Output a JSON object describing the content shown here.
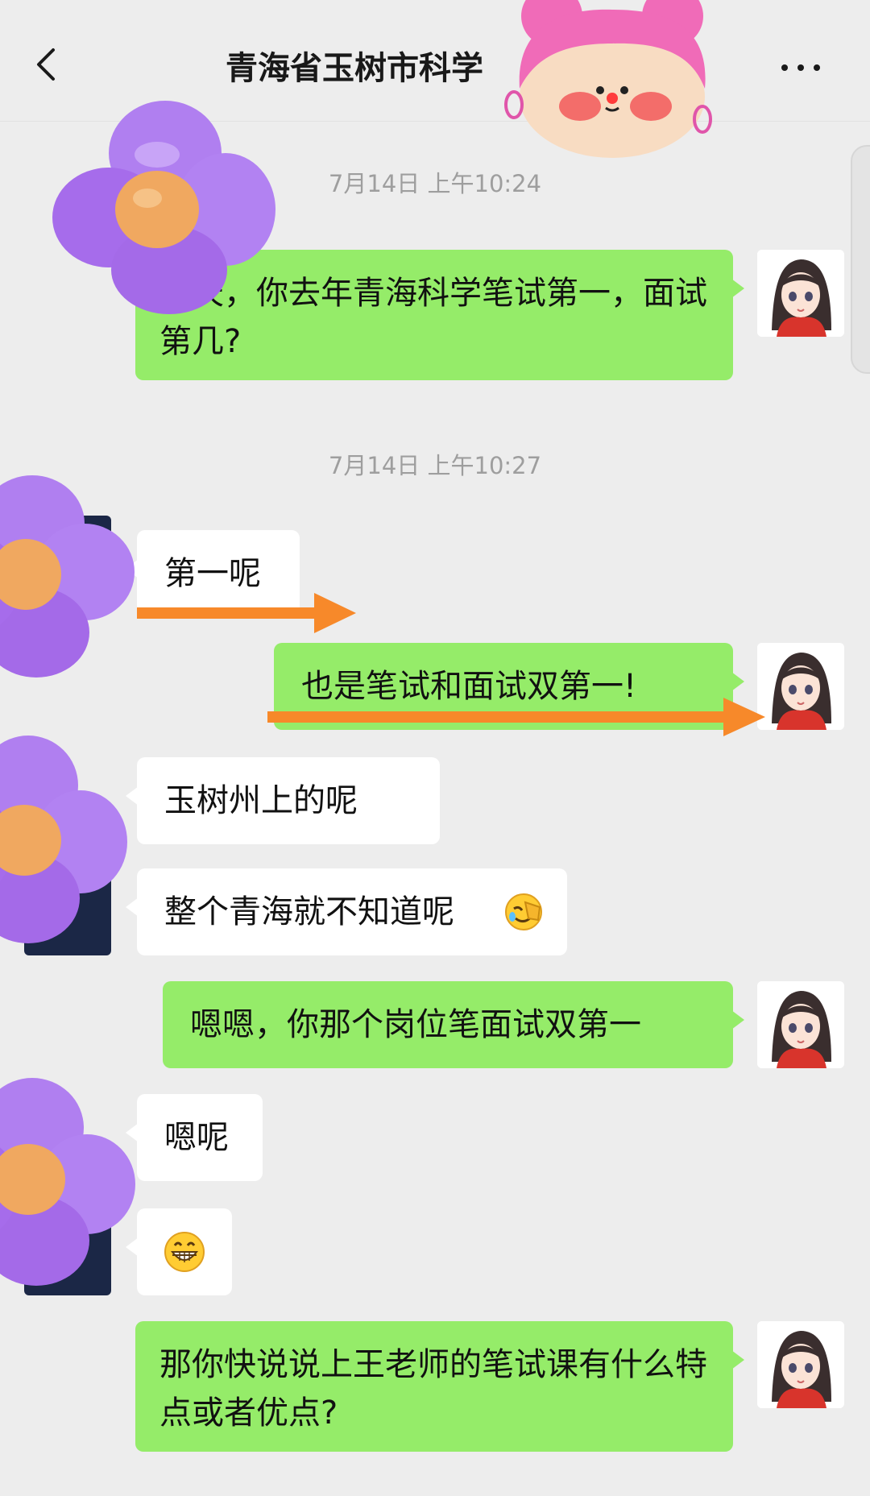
{
  "header": {
    "title": "青海省玉树市科学"
  },
  "timestamps": [
    "7月14日 上午10:24",
    "7月14日 上午10:27"
  ],
  "messages": [
    {
      "side": "right",
      "text": "昨天，你去年青海科学笔试第一，面试第几?"
    },
    {
      "side": "left",
      "text": "第一呢"
    },
    {
      "side": "right",
      "text": "也是笔试和面试双第一!"
    },
    {
      "side": "left",
      "text": "玉树州上的呢"
    },
    {
      "side": "left",
      "text": "整个青海就不知道呢"
    },
    {
      "side": "right",
      "text": "嗯嗯，你那个岗位笔面试双第一"
    },
    {
      "side": "left",
      "text": "嗯呢"
    },
    {
      "side": "left",
      "text": ""
    },
    {
      "side": "right",
      "text": "那你快说说上王老师的笔试课有什么特点或者优点?"
    }
  ],
  "icons": {
    "back": "chevron-left-icon",
    "more": "more-dots-icon",
    "facepalm_emoji": "facepalm-emoji-icon",
    "grin_emoji": "grin-emoji-icon"
  },
  "colors": {
    "background": "#ededed",
    "bubble_right": "#95ec69",
    "bubble_left": "#ffffff",
    "arrow": "#f7892a",
    "flower": "#b07ff0"
  }
}
